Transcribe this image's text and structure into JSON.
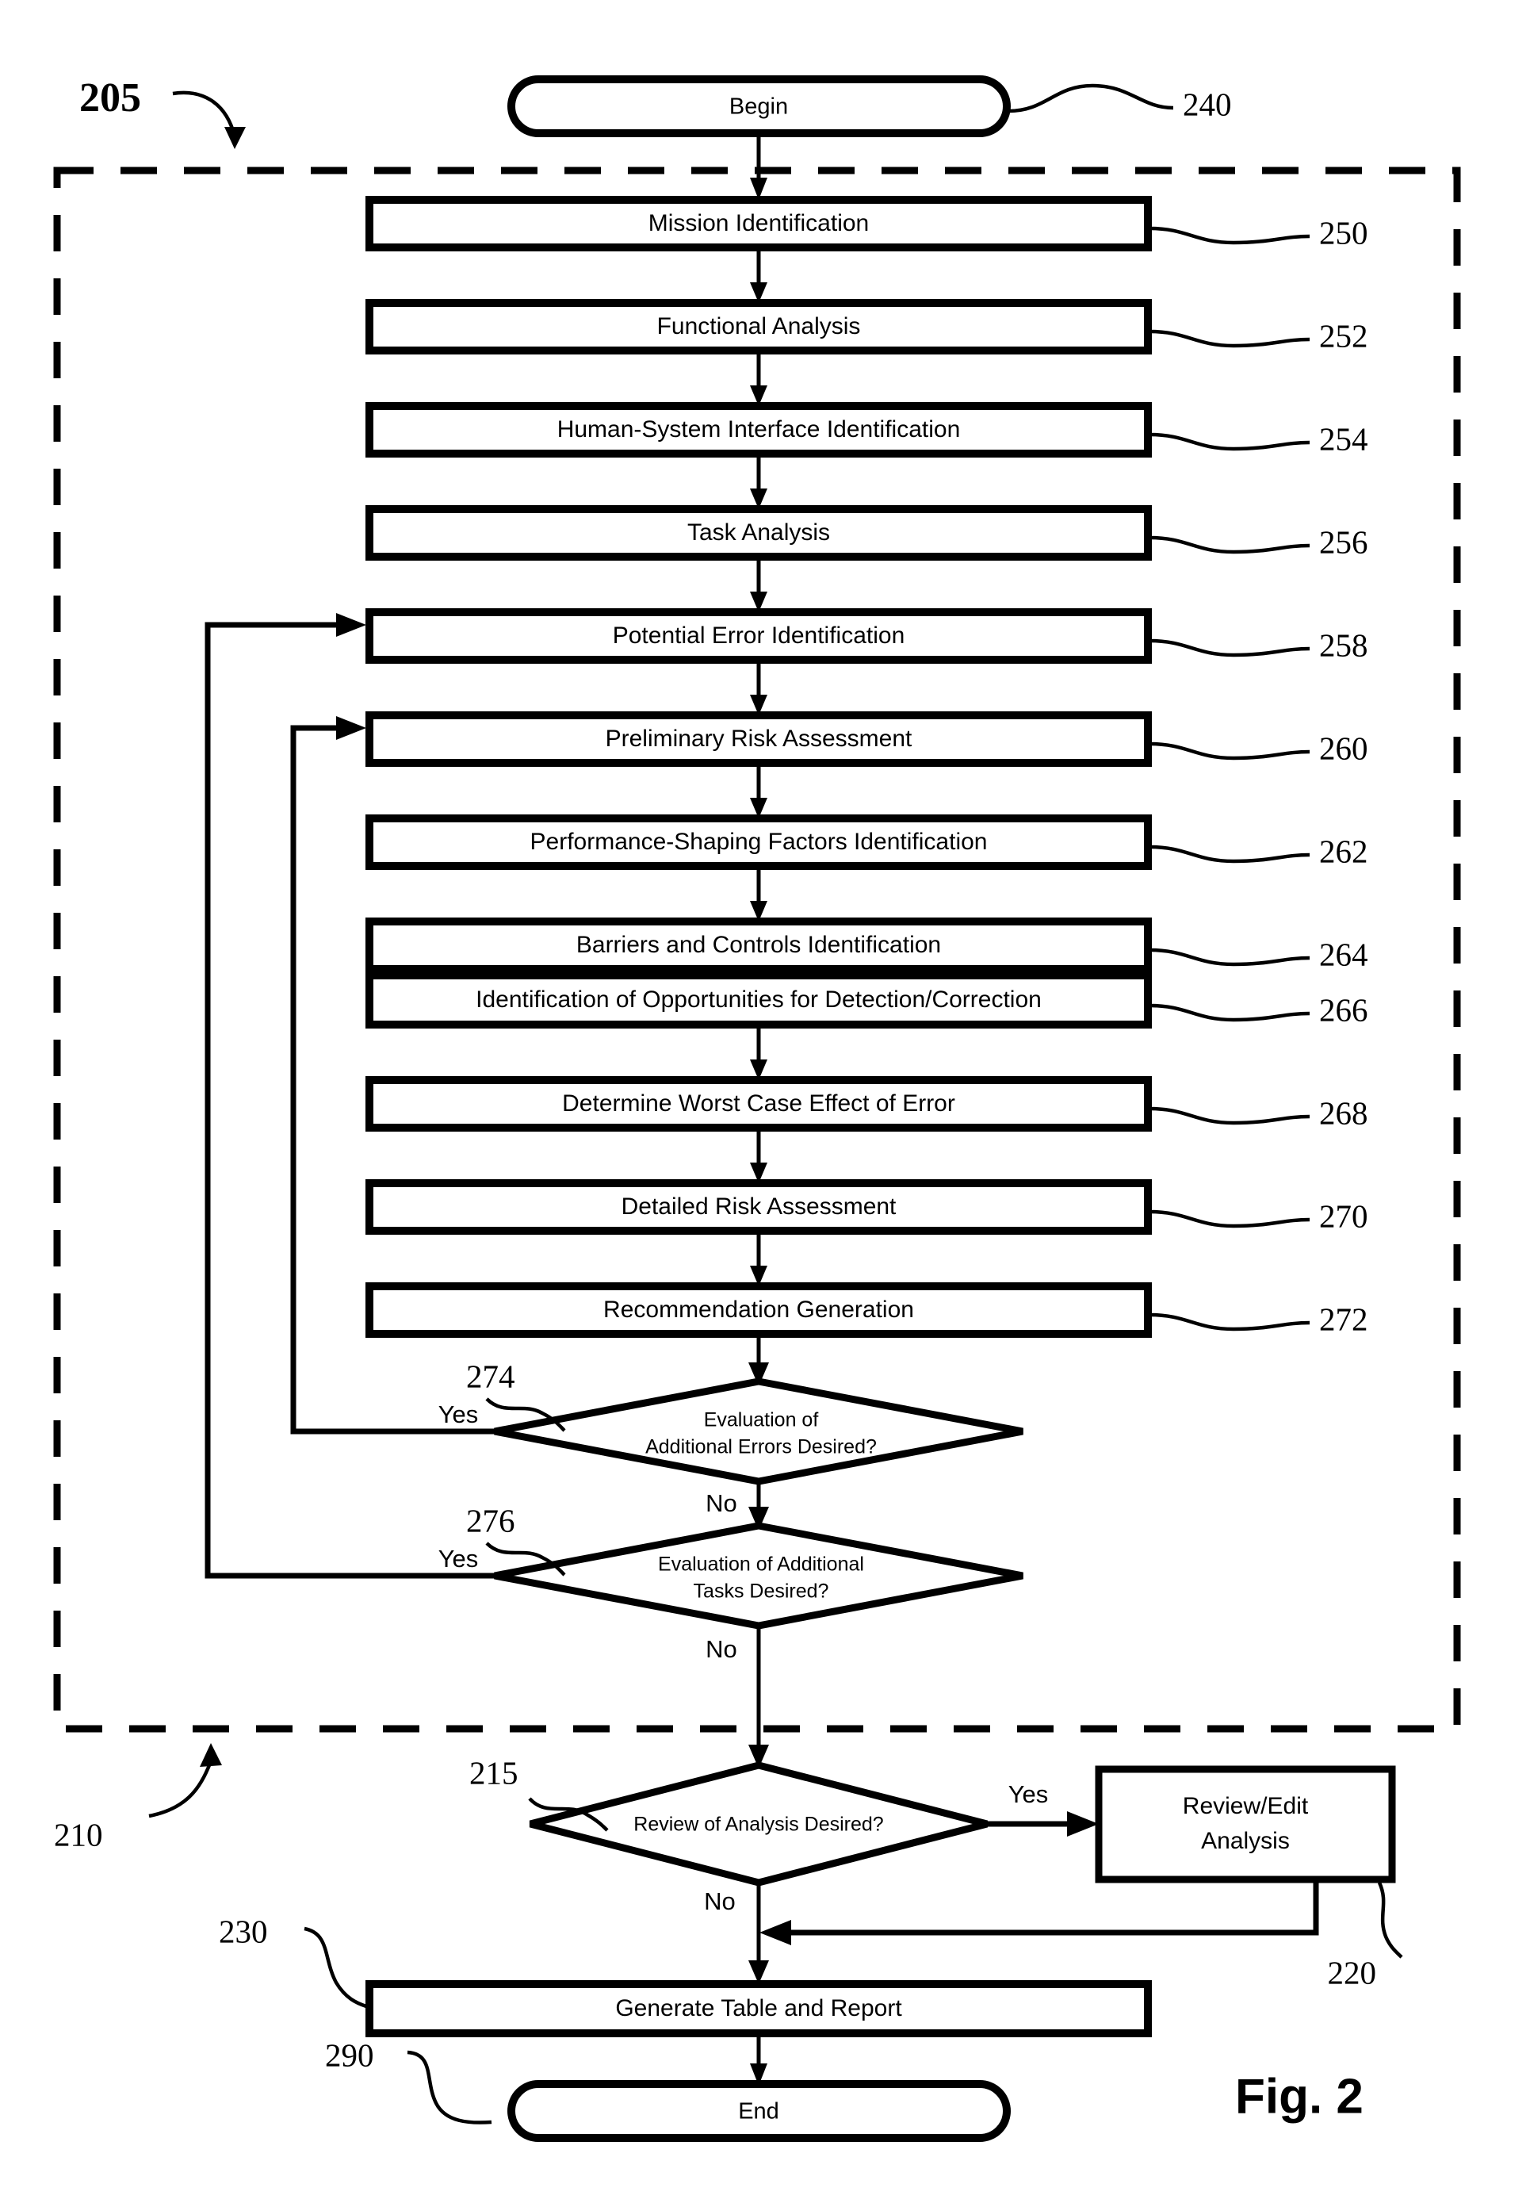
{
  "figure": {
    "caption": "Fig. 2",
    "group_ref": "205",
    "dashed_region_ref": "210"
  },
  "terminals": [
    {
      "id": "begin",
      "label": "Begin",
      "ref": "240"
    },
    {
      "id": "end",
      "label": "End",
      "ref": "290"
    }
  ],
  "process_steps": [
    {
      "ref": "250",
      "label": "Mission Identification"
    },
    {
      "ref": "252",
      "label": "Functional Analysis"
    },
    {
      "ref": "254",
      "label": "Human-System Interface Identification"
    },
    {
      "ref": "256",
      "label": "Task Analysis"
    },
    {
      "ref": "258",
      "label": "Potential Error Identification"
    },
    {
      "ref": "260",
      "label": "Preliminary Risk Assessment"
    },
    {
      "ref": "262",
      "label": "Performance-Shaping Factors Identification"
    },
    {
      "ref": "264",
      "label": "Barriers and Controls Identification"
    },
    {
      "ref": "266",
      "label": "Identification of Opportunities for Detection/Correction"
    },
    {
      "ref": "268",
      "label": "Determine Worst Case Effect of Error"
    },
    {
      "ref": "270",
      "label": "Detailed Risk Assessment"
    },
    {
      "ref": "272",
      "label": "Recommendation Generation"
    }
  ],
  "decisions": [
    {
      "ref": "274",
      "line1": "Evaluation of",
      "line2": "Additional Errors Desired?",
      "yes_label": "Yes",
      "no_label": "No"
    },
    {
      "ref": "276",
      "line1": "Evaluation of Additional",
      "line2": "Tasks Desired?",
      "yes_label": "Yes",
      "no_label": "No"
    },
    {
      "ref": "215",
      "line1": "Review of Analysis Desired?",
      "line2": "",
      "yes_label": "Yes",
      "no_label": "No"
    }
  ],
  "review_box": {
    "ref": "220",
    "line1": "Review/Edit",
    "line2": "Analysis"
  },
  "report_box": {
    "ref": "230",
    "label": "Generate Table and Report"
  },
  "colors": {
    "ink": "#000000",
    "paper": "#ffffff"
  }
}
